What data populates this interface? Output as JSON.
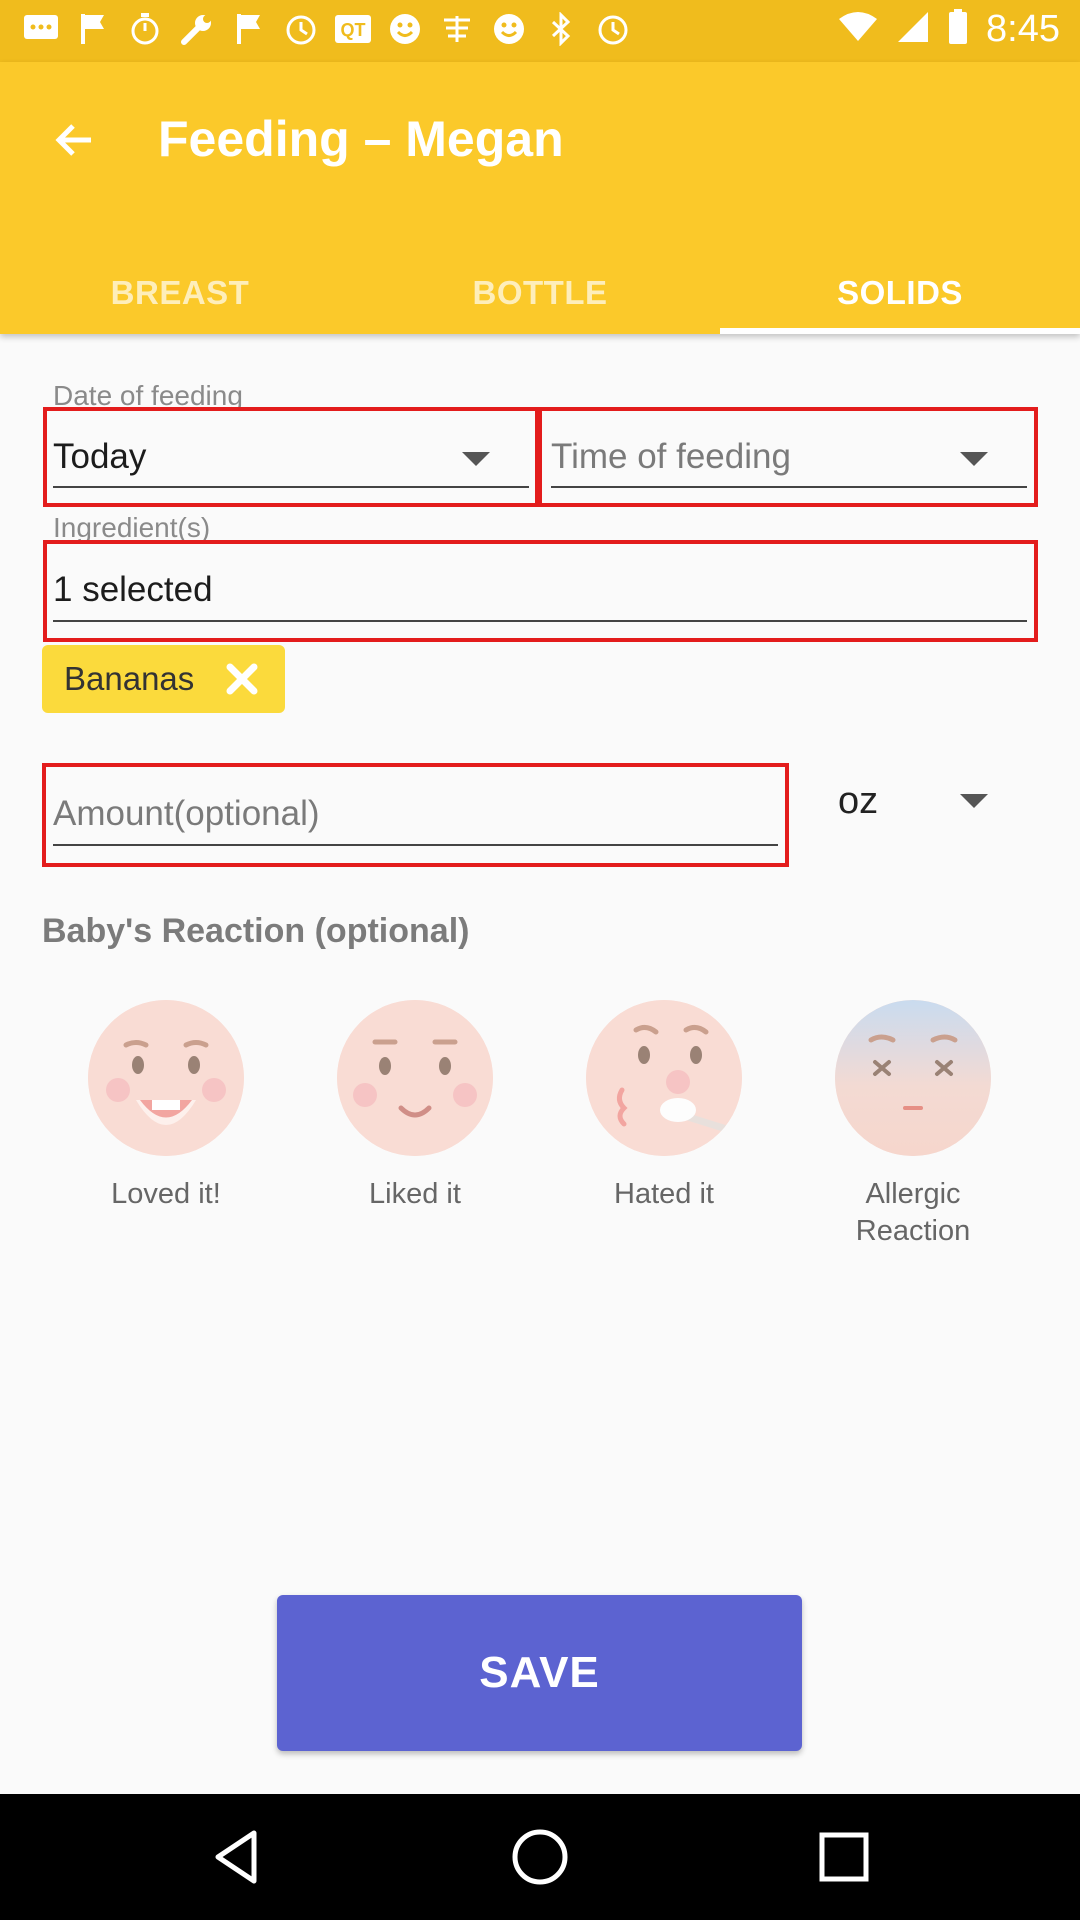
{
  "status_bar": {
    "time": "8:45",
    "icons": [
      "message-icon",
      "flag-icon",
      "stopwatch-icon",
      "wrench-icon",
      "flag-icon",
      "alarm-icon",
      "qr-icon",
      "smiley-icon",
      "chinese-icon",
      "smiley-icon",
      "bluetooth-icon",
      "alarm-icon",
      "wifi-icon",
      "signal-icon",
      "battery-icon"
    ]
  },
  "app_bar": {
    "title": "Feeding – Megan",
    "tabs": [
      {
        "label": "BREAST",
        "active": false
      },
      {
        "label": "BOTTLE",
        "active": false
      },
      {
        "label": "SOLIDS",
        "active": true
      }
    ]
  },
  "form": {
    "date_label": "Date of feeding",
    "date_value": "Today",
    "time_placeholder": "Time of feeding",
    "ingredients_label": "Ingredient(s)",
    "ingredients_value": "1 selected",
    "chips": [
      {
        "label": "Bananas"
      }
    ],
    "amount_placeholder": "Amount(optional)",
    "unit": "oz"
  },
  "reactions": {
    "title": "Baby's Reaction (optional)",
    "items": [
      {
        "label": "Loved it!"
      },
      {
        "label": "Liked it"
      },
      {
        "label": "Hated it"
      },
      {
        "label": "Allergic\nReaction"
      }
    ]
  },
  "save_label": "SAVE",
  "colors": {
    "status_bar": "#f0bc1d",
    "app_bar": "#fbc92a",
    "chip": "#fbda3c",
    "highlight_border": "#e31c1c",
    "save_button": "#5c63d1"
  }
}
